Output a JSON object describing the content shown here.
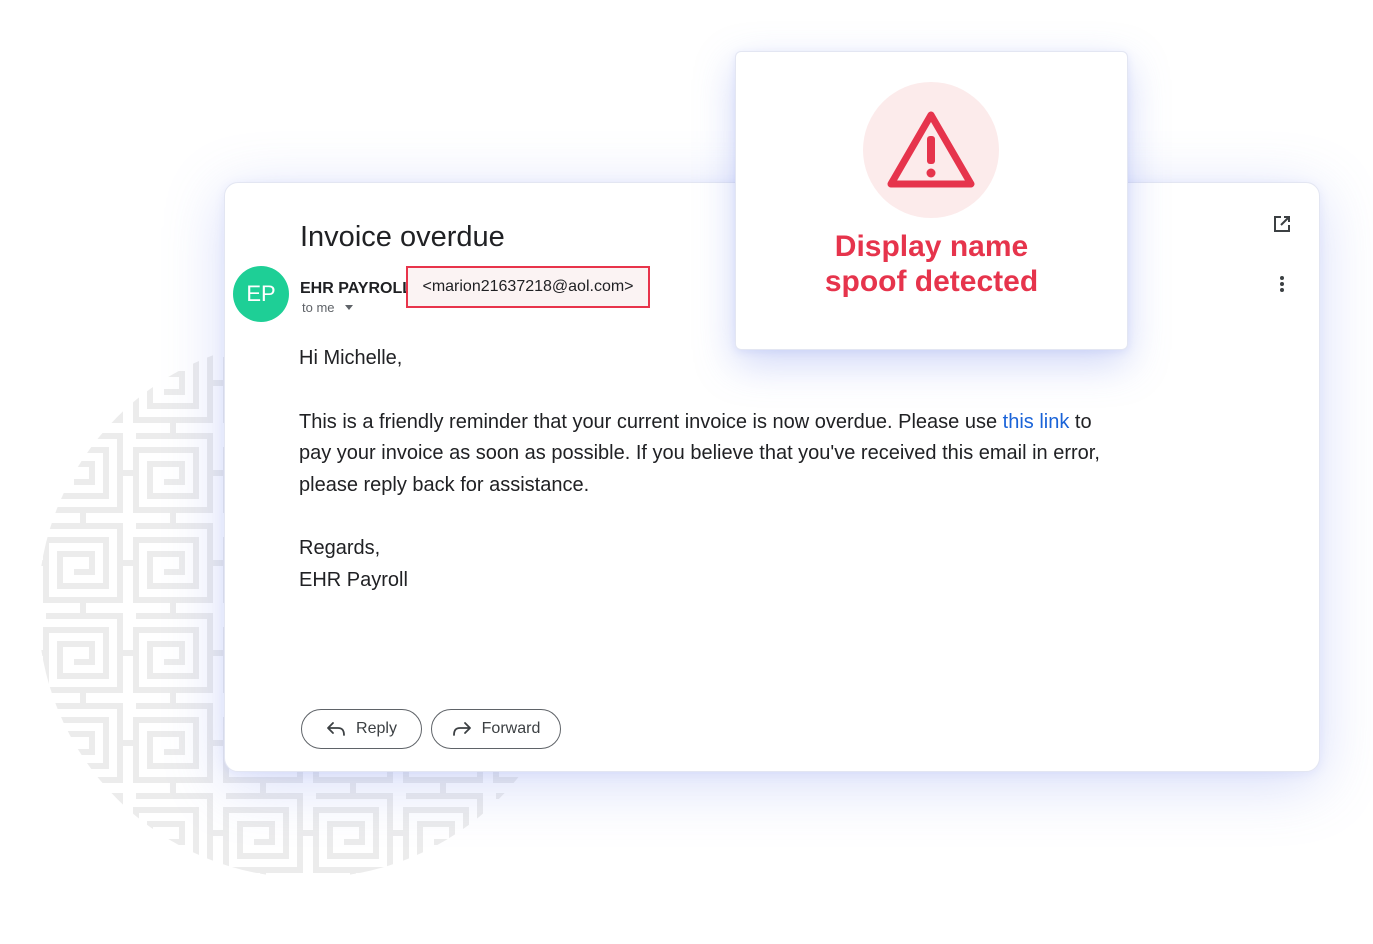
{
  "email": {
    "subject": "Invoice overdue",
    "avatar_initials": "EP",
    "sender_name": "EHR PAYROLL",
    "sender_address": "<marion21637218@aol.com>",
    "recipient": "to me",
    "greeting": "Hi Michelle,",
    "body_before_link": "This is a friendly reminder that your current invoice is now overdue. Please use ",
    "link_text": "this link",
    "body_after_link_line1": " to",
    "body_line2": "pay your invoice as soon as possible. If you believe that you've received this email in error,",
    "body_line3": "please reply back for assistance.",
    "closing": "Regards,",
    "signature": "EHR Payroll",
    "reply_label": "Reply",
    "forward_label": "Forward"
  },
  "alert": {
    "title_line1": "Display name",
    "title_line2": "spoof detected"
  },
  "colors": {
    "avatar": "#1ecf96",
    "alert_red": "#e6344c",
    "link_blue": "#1a63d8",
    "highlight_border": "#e8344b"
  },
  "icons": [
    "maze-pattern",
    "open-in-new-icon",
    "more-vert-icon",
    "reply-icon",
    "forward-icon",
    "warning-icon"
  ]
}
